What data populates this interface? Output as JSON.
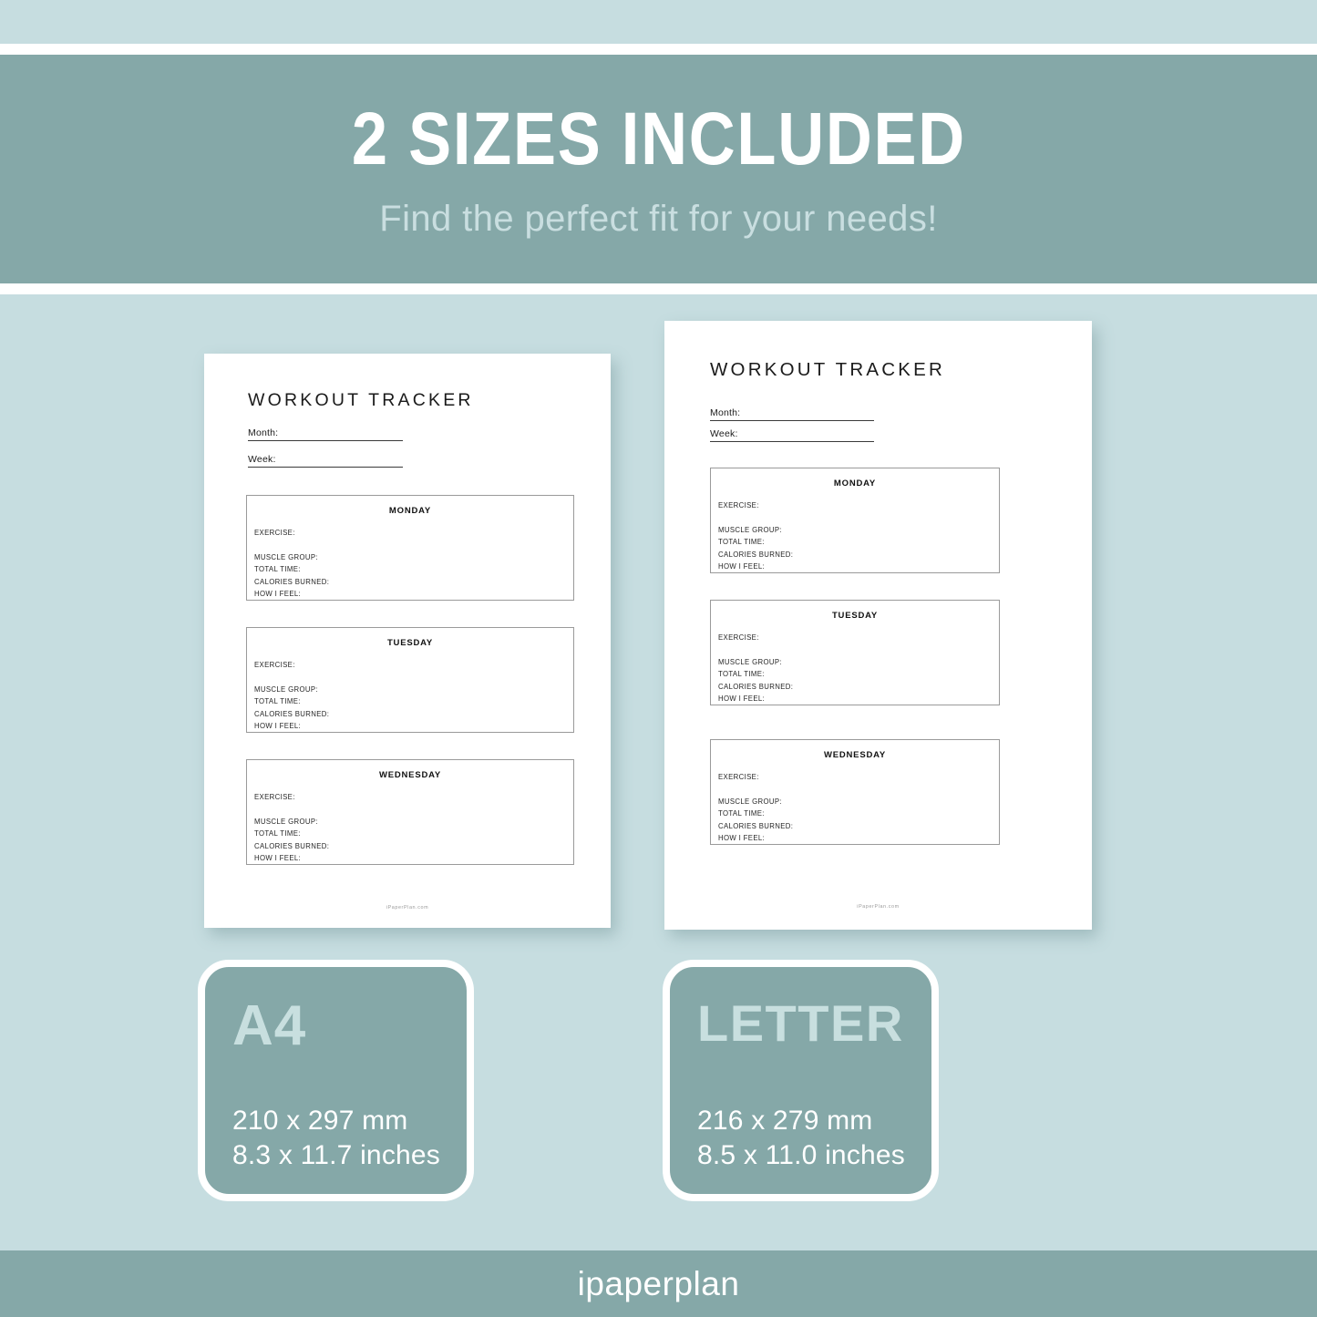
{
  "banner": {
    "title": "2 SIZES INCLUDED",
    "subtitle": "Find the perfect fit for your needs!"
  },
  "previews": [
    {
      "size_name": "A4",
      "doc_title": "WORKOUT TRACKER",
      "fields": [
        {
          "label": "Month:"
        },
        {
          "label": "Week:"
        }
      ],
      "days": [
        {
          "title": "MONDAY",
          "lines": [
            "EXERCISE:",
            "",
            "MUSCLE GROUP:",
            "TOTAL TIME:",
            "CALORIES BURNED:",
            "HOW I FEEL:"
          ]
        },
        {
          "title": "TUESDAY",
          "lines": [
            "EXERCISE:",
            "",
            "MUSCLE GROUP:",
            "TOTAL TIME:",
            "CALORIES BURNED:",
            "HOW I FEEL:"
          ]
        },
        {
          "title": "WEDNESDAY",
          "lines": [
            "EXERCISE:",
            "",
            "MUSCLE GROUP:",
            "TOTAL TIME:",
            "CALORIES BURNED:",
            "HOW I FEEL:"
          ]
        }
      ],
      "credit": "iPaperPlan.com"
    },
    {
      "size_name": "LETTER",
      "doc_title": "WORKOUT TRACKER",
      "fields": [
        {
          "label": "Month:"
        },
        {
          "label": "Week:"
        }
      ],
      "days": [
        {
          "title": "MONDAY",
          "lines": [
            "EXERCISE:",
            "",
            "MUSCLE GROUP:",
            "TOTAL TIME:",
            "CALORIES BURNED:",
            "HOW I FEEL:"
          ]
        },
        {
          "title": "TUESDAY",
          "lines": [
            "EXERCISE:",
            "",
            "MUSCLE GROUP:",
            "TOTAL TIME:",
            "CALORIES BURNED:",
            "HOW I FEEL:"
          ]
        },
        {
          "title": "WEDNESDAY",
          "lines": [
            "EXERCISE:",
            "",
            "MUSCLE GROUP:",
            "TOTAL TIME:",
            "CALORIES BURNED:",
            "HOW I FEEL:"
          ]
        }
      ],
      "credit": "iPaperPlan.com"
    }
  ],
  "badges": [
    {
      "name": "A4",
      "mm": "210 x 297 mm",
      "inches": "8.3 x 11.7 inches"
    },
    {
      "name": "LETTER",
      "mm": "216 x 279 mm",
      "inches": "8.5 x 11.0 inches"
    }
  ],
  "footer": {
    "brand": "ipaperplan"
  },
  "colors": {
    "background": "#c6dde0",
    "teal": "#85a8a8",
    "white": "#ffffff",
    "subtitle": "#c9dee0",
    "badge_name": "#c8dfdf",
    "paper": "#ffffff",
    "box_border": "#9a9a9a",
    "ink": "#1b1b1b"
  }
}
